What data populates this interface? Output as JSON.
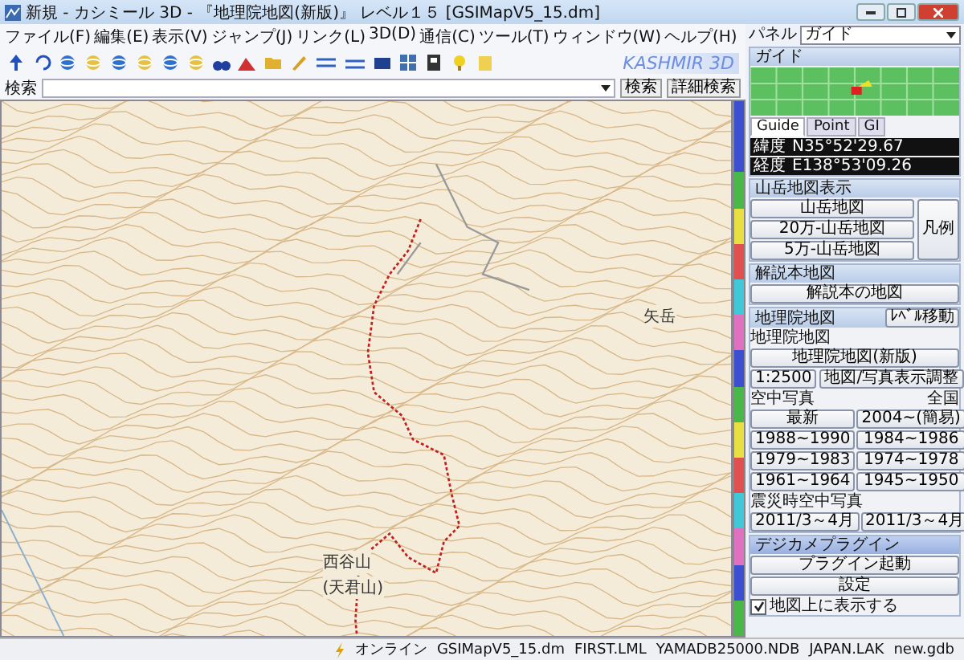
{
  "window": {
    "title": "新規 - カシミール 3D - 『地理院地図(新版)』 レベル１５ [GSIMapV5_15.dm]"
  },
  "menu": [
    "ファイル(F)",
    "編集(E)",
    "表示(V)",
    "ジャンプ(J)",
    "リンク(L)",
    "3D(D)",
    "通信(C)",
    "ツール(T)",
    "ウィンドウ(W)",
    "ヘルプ(H)"
  ],
  "logo": "KASHMIR 3D",
  "search": {
    "label": "検索",
    "buttons": [
      "検索",
      "詳細検索"
    ]
  },
  "panel": {
    "label": "パネル",
    "value": "ガイド"
  },
  "guide": {
    "title": "ガイド",
    "tabs": [
      {
        "label": "Guide",
        "selected": true
      },
      {
        "label": "Point",
        "selected": false
      },
      {
        "label": "GI",
        "selected": false
      }
    ],
    "coords": [
      {
        "label": "緯度",
        "value": "N35°52'29.67"
      },
      {
        "label": "経度",
        "value": "E138°53'09.26"
      }
    ]
  },
  "mountain_maps": {
    "title": "山岳地図表示",
    "buttons": [
      "山岳地図",
      "20万-山岳地図",
      "5万-山岳地図"
    ],
    "legend": "凡例"
  },
  "guidebook": {
    "title": "解説本地図",
    "button": "解説本の地図"
  },
  "gsi": {
    "title": "地理院地図",
    "level_button": "ﾚﾍﾞﾙ移動",
    "label": "地理院地図",
    "button": "地理院地図(新版)",
    "scale": "1:2500",
    "adjust": "地図/写真表示調整",
    "aerial_label": "空中写真",
    "aerial_scope": "全国",
    "aerial": [
      "最新",
      "2004~(簡易)",
      "1988~1990",
      "1984~1986",
      "1979~1983",
      "1974~1978",
      "1961~1964",
      "1945~1950"
    ],
    "quake_label": "震災時空中写真",
    "quake": [
      "2011/3～4月",
      "2011/3～4月"
    ]
  },
  "plugin": {
    "title": "デジカメプラグイン",
    "buttons": [
      "プラグイン起動",
      "設定"
    ],
    "checkbox": {
      "label": "地図上に表示する",
      "checked": true
    }
  },
  "map": {
    "labels": [
      "西谷山",
      "(天君山)",
      "矢岳"
    ]
  },
  "status_bar": {
    "online": "オンライン",
    "files": [
      "GSIMapV5_15.dm",
      "FIRST.LML",
      "YAMADB25000.NDB",
      "JAPAN.LAK",
      "new.gdb"
    ]
  }
}
